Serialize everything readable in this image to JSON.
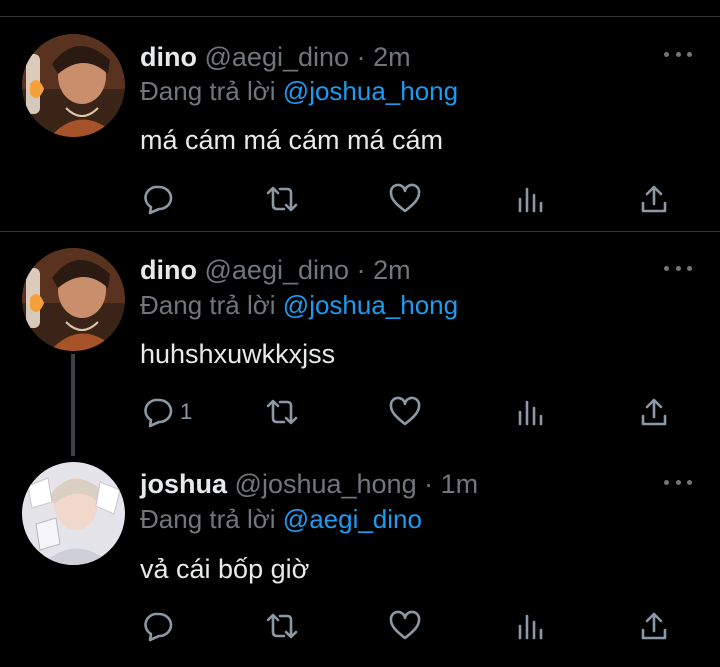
{
  "colors": {
    "background": "#000000",
    "text": "#e7e9ea",
    "secondary": "#71767b",
    "link": "#1d9bf0",
    "divider": "#2f3336"
  },
  "icons": [
    "reply-icon",
    "retweet-icon",
    "like-icon",
    "views-icon",
    "share-icon",
    "more-icon"
  ],
  "tweets": [
    {
      "display_name": "dino",
      "handle": "@aegi_dino",
      "separator": "·",
      "time": "2m",
      "reply_prefix": "Đang trả lời",
      "reply_to": "@joshua_hong",
      "text": "má cám má cám má cám",
      "reply_count": ""
    },
    {
      "display_name": "dino",
      "handle": "@aegi_dino",
      "separator": "·",
      "time": "2m",
      "reply_prefix": "Đang trả lời",
      "reply_to": "@joshua_hong",
      "text": "huhshxuwkkxjss",
      "reply_count": "1"
    },
    {
      "display_name": "joshua",
      "handle": "@joshua_hong",
      "separator": "·",
      "time": "1m",
      "reply_prefix": "Đang trả lời",
      "reply_to": "@aegi_dino",
      "text": "vả cái bốp giờ",
      "reply_count": ""
    }
  ]
}
